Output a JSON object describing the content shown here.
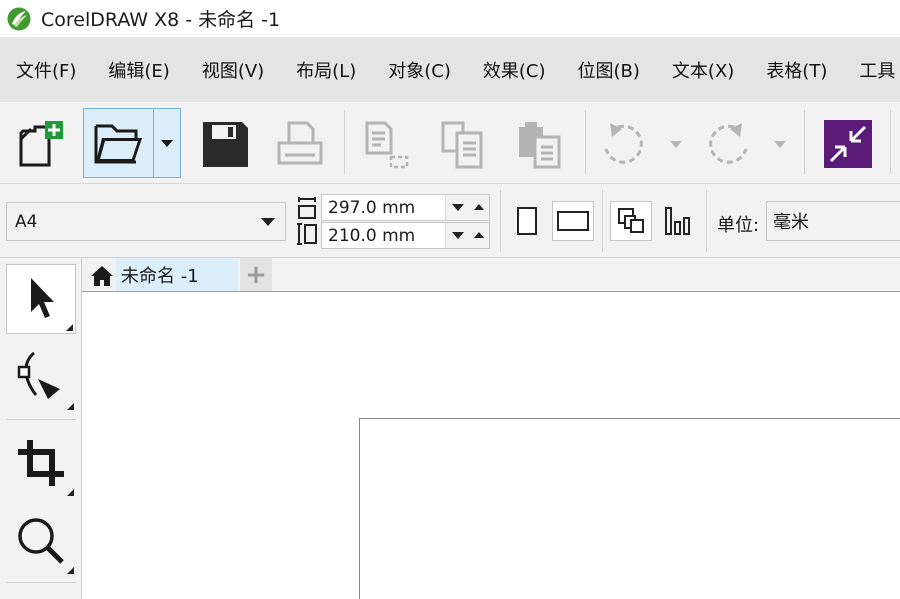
{
  "window": {
    "title": "CorelDRAW X8 - 未命名 -1",
    "logo_icon": "coreldraw-balloon-icon",
    "logo_color": "#2f8f2f"
  },
  "menu": [
    {
      "label": "文件(F)"
    },
    {
      "label": "编辑(E)"
    },
    {
      "label": "视图(V)"
    },
    {
      "label": "布局(L)"
    },
    {
      "label": "对象(C)"
    },
    {
      "label": "效果(C)"
    },
    {
      "label": "位图(B)"
    },
    {
      "label": "文本(X)"
    },
    {
      "label": "表格(T)"
    },
    {
      "label": "工具"
    }
  ],
  "toolbar": {
    "buttons": [
      "new-document-icon",
      "open-folder-icon",
      "save-disk-icon",
      "print-icon",
      "cut-icon",
      "copy-icon",
      "paste-icon",
      "undo-icon",
      "redo-icon",
      "import-icon"
    ],
    "accent_color": "#5a1a78"
  },
  "property_bar": {
    "paper_size": "A4",
    "width_value": "297.0 mm",
    "height_value": "210.0 mm",
    "unit_label": "单位:",
    "unit_value": "毫米"
  },
  "toolbox": {
    "tools": [
      "pick-tool-icon",
      "shape-tool-icon",
      "crop-tool-icon",
      "zoom-tool-icon"
    ]
  },
  "tabs": {
    "document_tab": "未命名 -1",
    "add_tab_symbol": "+"
  }
}
